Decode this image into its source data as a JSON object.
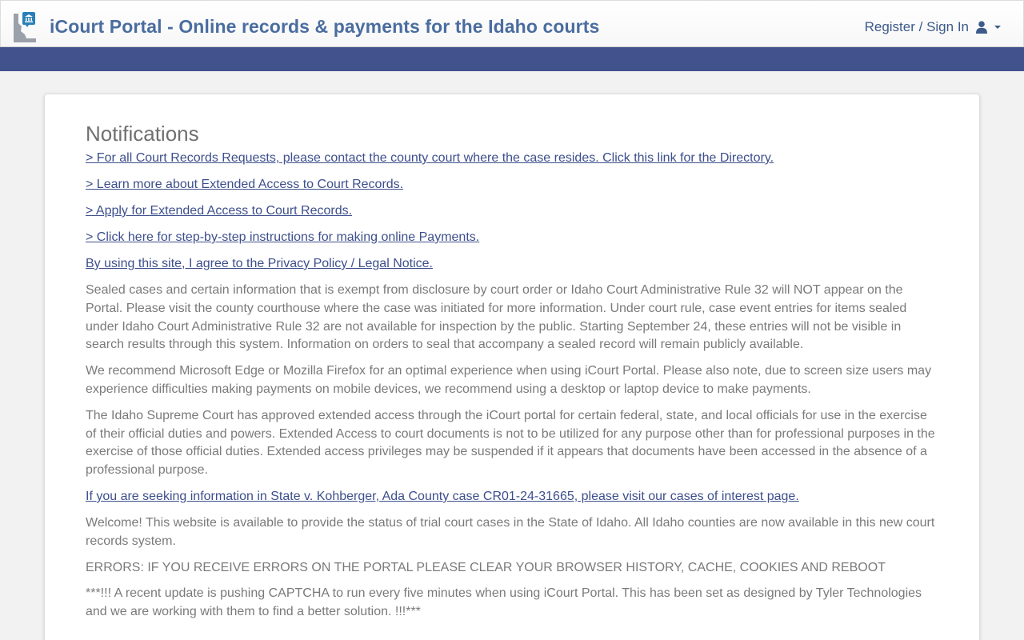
{
  "header": {
    "title": "iCourt Portal - Online records & payments for the Idaho courts",
    "user_menu_label": "Register / Sign In",
    "logo_icon": "idaho-courthouse-logo-icon"
  },
  "colors": {
    "title": "#4a6d9f",
    "navbar": "#42528d",
    "link": "#3d4f8c",
    "text": "#7a7a7a"
  },
  "notifications": {
    "heading": "Notifications",
    "links": {
      "records_requests": "> For all Court Records Requests, please contact the county court where the case resides. Click this link for the Directory.",
      "learn_extended": "> Learn more about Extended Access to Court Records.",
      "apply_extended": "> Apply for Extended Access to Court Records.",
      "payment_instructions": "> Click here for step-by-step instructions for making online Payments.",
      "privacy_policy": "By using this site, I agree to the Privacy Policy / Legal Notice."
    },
    "paragraphs": {
      "sealed_cases": "Sealed cases and certain information that is exempt from disclosure by court order or Idaho Court Administrative Rule 32 will NOT appear on the Portal. Please visit the county courthouse where the case was initiated for more information. Under court rule, case event entries for items sealed under Idaho Court Administrative Rule 32 are not available for inspection by the public. Starting September 24, these entries will not be visible in search results through this system. Information on orders to seal that accompany a sealed record will remain publicly available.",
      "browser_recommendation": "We recommend Microsoft Edge or Mozilla Firefox for an optimal experience when using iCourt Portal. Please also note, due to screen size users may experience difficulties making payments on mobile devices, we recommend using a desktop or laptop device to make payments.",
      "extended_access": "The Idaho Supreme Court has approved extended access through the iCourt portal for certain federal, state, and local officials for use in the exercise of their official duties and powers. Extended Access to court documents is not to be utilized for any purpose other than for professional purposes in the exercise of those official duties. Extended access privileges may be suspended if it appears that documents have been accessed in the absence of a professional purpose.",
      "welcome": "Welcome! This website is available to provide the status of trial court cases in the State of Idaho. All Idaho counties are now available in this new court records system.",
      "errors": "ERRORS: IF YOU RECEIVE ERRORS ON THE PORTAL PLEASE CLEAR YOUR BROWSER HISTORY, CACHE, COOKIES AND REBOOT",
      "captcha": "***!!! A recent update is pushing CAPTCHA to run every five minutes when using iCourt Portal. This has been set as designed by Tyler Technologies and we are working with them to find a better solution. !!!***"
    },
    "kohberger_link": "If you are seeking information in State v. Kohberger, Ada County case CR01-24-31665, please visit our cases of interest page."
  }
}
